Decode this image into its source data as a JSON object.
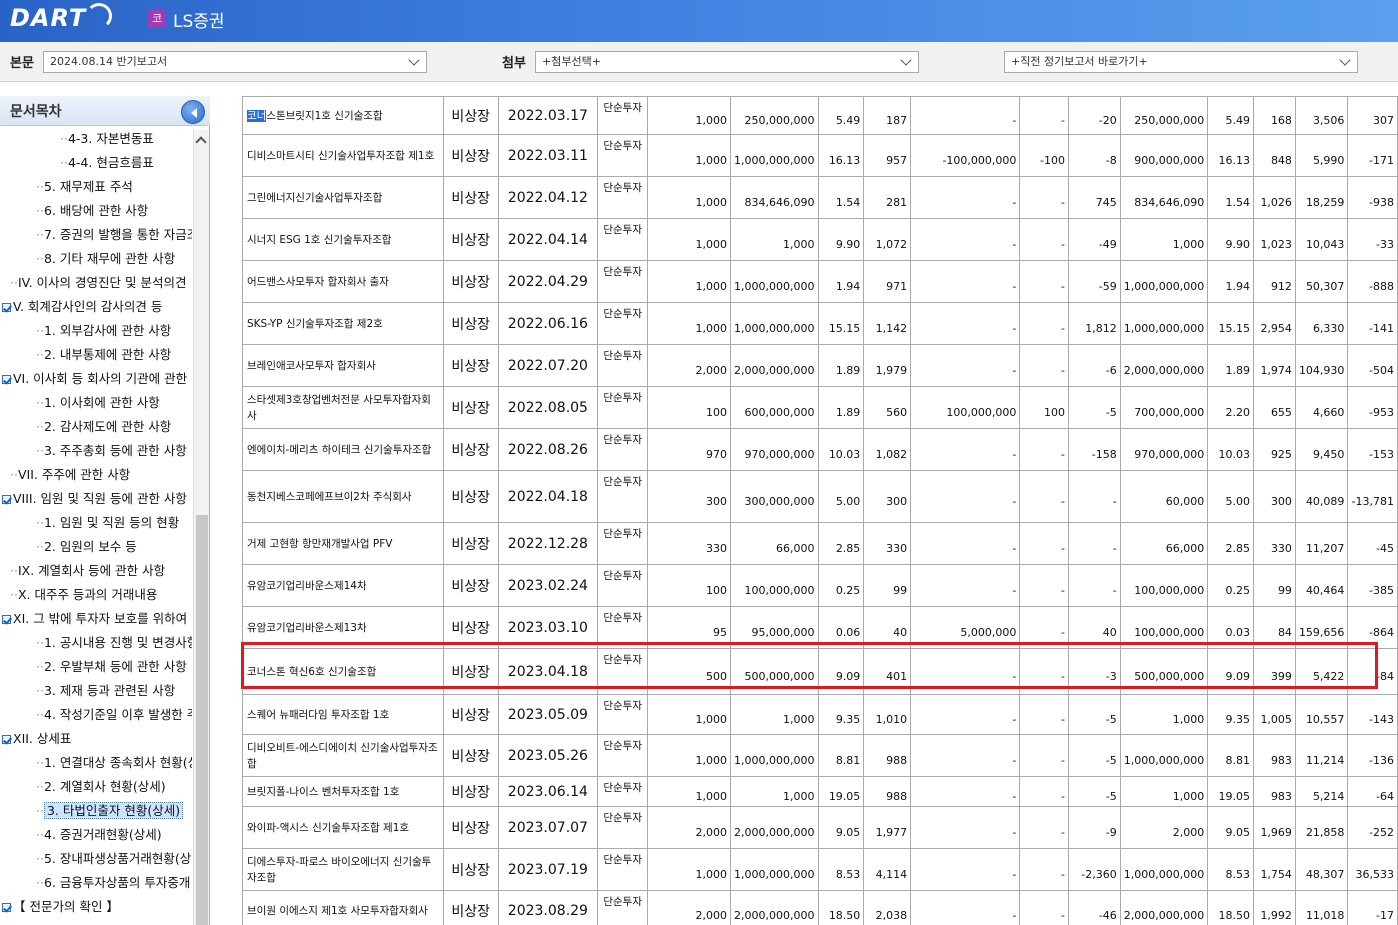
{
  "header": {
    "logo_text": "DART",
    "company_badge": "코",
    "company_name": "LS증권"
  },
  "toolbar": {
    "main_label": "본문",
    "main_select": "2024.08.14  반기보고서",
    "attach_label": "첨부",
    "attach_select": "+첨부선택+",
    "recent_select": "+직전 정기보고서 바로가기+"
  },
  "sidebar": {
    "title": "문서목차",
    "items": [
      {
        "label": "4-3. 자본변동표",
        "indent": 3
      },
      {
        "label": "4-4. 현금흐름표",
        "indent": 3
      },
      {
        "label": "5. 재무제표 주석",
        "indent": 2
      },
      {
        "label": "6. 배당에 관한 사항",
        "indent": 2
      },
      {
        "label": "7. 증권의 발행을 통한 자금조",
        "indent": 2
      },
      {
        "label": "8. 기타 재무에 관한 사항",
        "indent": 2
      },
      {
        "label": "IV. 이사의 경영진단 및 분석의견",
        "indent": 1
      },
      {
        "label": "V. 회계감사인의 감사의견 등",
        "indent": 0,
        "check": true
      },
      {
        "label": "1. 외부감사에 관한 사항",
        "indent": 2
      },
      {
        "label": "2. 내부통제에 관한 사항",
        "indent": 2
      },
      {
        "label": "VI. 이사회 등 회사의 기관에 관한",
        "indent": 0,
        "check": true
      },
      {
        "label": "1. 이사회에 관한 사항",
        "indent": 2
      },
      {
        "label": "2. 감사제도에 관한 사항",
        "indent": 2
      },
      {
        "label": "3. 주주총회 등에 관한 사항",
        "indent": 2
      },
      {
        "label": "VII. 주주에 관한 사항",
        "indent": 1
      },
      {
        "label": "VIII. 임원 및 직원 등에 관한 사항",
        "indent": 0,
        "check": true
      },
      {
        "label": "1. 임원 및 직원 등의 현황",
        "indent": 2
      },
      {
        "label": "2. 임원의 보수 등",
        "indent": 2
      },
      {
        "label": "IX. 계열회사 등에 관한 사항",
        "indent": 1
      },
      {
        "label": "X. 대주주 등과의 거래내용",
        "indent": 1
      },
      {
        "label": "XI. 그 밖에 투자자 보호를 위하여",
        "indent": 0,
        "check": true
      },
      {
        "label": "1. 공시내용 진행 및 변경사항",
        "indent": 2
      },
      {
        "label": "2. 우발부채 등에 관한 사항",
        "indent": 2
      },
      {
        "label": "3. 제재 등과 관련된 사항",
        "indent": 2
      },
      {
        "label": "4. 작성기준일 이후 발생한 주",
        "indent": 2
      },
      {
        "label": "XII. 상세표",
        "indent": 0,
        "check": true
      },
      {
        "label": "1. 연결대상 종속회사 현황(상",
        "indent": 2
      },
      {
        "label": "2. 계열회사 현황(상세)",
        "indent": 2
      },
      {
        "label": "3. 타법인출자 현황(상세)",
        "indent": 2,
        "selected": true
      },
      {
        "label": "4. 증권거래현황(상세)",
        "indent": 2
      },
      {
        "label": "5. 장내파생상품거래현황(상",
        "indent": 2
      },
      {
        "label": "6. 금융투자상품의 투자중개",
        "indent": 2
      },
      {
        "label": "【 전문가의 확인 】",
        "indent": 0,
        "check": true
      }
    ]
  },
  "table": {
    "rows": [
      {
        "name": "코너스톤브릿지1호 신기술조합",
        "name_hl": "코너",
        "listed": "비상장",
        "date": "2022.03.17",
        "purpose": "단순투자",
        "c1": "1,000",
        "c2": "250,000,000",
        "c3": "5.49",
        "c4": "187",
        "c5": "-",
        "c6": "-",
        "c7": "-20",
        "c8": "250,000,000",
        "c9": "5.49",
        "c10": "168",
        "c11": "3,506",
        "c12": "307"
      },
      {
        "name": "디비스마트시티 신기술사업투자조합 제1호",
        "listed": "비상장",
        "date": "2022.03.11",
        "purpose": "단순투자",
        "c1": "1,000",
        "c2": "1,000,000,000",
        "c3": "16.13",
        "c4": "957",
        "c5": "-100,000,000",
        "c6": "-100",
        "c7": "-8",
        "c8": "900,000,000",
        "c9": "16.13",
        "c10": "848",
        "c11": "5,990",
        "c12": "-171"
      },
      {
        "name": "그린에너지신기술사업투자조합",
        "listed": "비상장",
        "date": "2022.04.12",
        "purpose": "단순투자",
        "c1": "1,000",
        "c2": "834,646,090",
        "c3": "1.54",
        "c4": "281",
        "c5": "-",
        "c6": "-",
        "c7": "745",
        "c8": "834,646,090",
        "c9": "1.54",
        "c10": "1,026",
        "c11": "18,259",
        "c12": "-938"
      },
      {
        "name": "시너지 ESG 1호 신기술투자조합",
        "listed": "비상장",
        "date": "2022.04.14",
        "purpose": "단순투자",
        "c1": "1,000",
        "c2": "1,000",
        "c3": "9.90",
        "c4": "1,072",
        "c5": "-",
        "c6": "-",
        "c7": "-49",
        "c8": "1,000",
        "c9": "9.90",
        "c10": "1,023",
        "c11": "10,043",
        "c12": "-33"
      },
      {
        "name": "어드밴스사모투자 합자회사 출자",
        "listed": "비상장",
        "date": "2022.04.29",
        "purpose": "단순투자",
        "c1": "1,000",
        "c2": "1,000,000,000",
        "c3": "1.94",
        "c4": "971",
        "c5": "-",
        "c6": "-",
        "c7": "-59",
        "c8": "1,000,000,000",
        "c9": "1.94",
        "c10": "912",
        "c11": "50,307",
        "c12": "-888"
      },
      {
        "name": "SKS-YP 신기술투자조합 제2호",
        "listed": "비상장",
        "date": "2022.06.16",
        "purpose": "단순투자",
        "c1": "1,000",
        "c2": "1,000,000,000",
        "c3": "15.15",
        "c4": "1,142",
        "c5": "-",
        "c6": "-",
        "c7": "1,812",
        "c8": "1,000,000,000",
        "c9": "15.15",
        "c10": "2,954",
        "c11": "6,330",
        "c12": "-141"
      },
      {
        "name": "브레인애코사모투자 합자회사",
        "listed": "비상장",
        "date": "2022.07.20",
        "purpose": "단순투자",
        "c1": "2,000",
        "c2": "2,000,000,000",
        "c3": "1.89",
        "c4": "1,979",
        "c5": "-",
        "c6": "-",
        "c7": "-6",
        "c8": "2,000,000,000",
        "c9": "1.89",
        "c10": "1,974",
        "c11": "104,930",
        "c12": "-504"
      },
      {
        "name": "스타셋제3호창업벤처전문 사모투자합자회사",
        "listed": "비상장",
        "date": "2022.08.05",
        "purpose": "단순투자",
        "c1": "100",
        "c2": "600,000,000",
        "c3": "1.89",
        "c4": "560",
        "c5": "100,000,000",
        "c6": "100",
        "c7": "-5",
        "c8": "700,000,000",
        "c9": "2.20",
        "c10": "655",
        "c11": "4,660",
        "c12": "-953"
      },
      {
        "name": "엔에이치-메리츠 하이테크 신기술투자조합",
        "listed": "비상장",
        "date": "2022.08.26",
        "purpose": "단순투자",
        "c1": "970",
        "c2": "970,000,000",
        "c3": "10.03",
        "c4": "1,082",
        "c5": "-",
        "c6": "-",
        "c7": "-158",
        "c8": "970,000,000",
        "c9": "10.03",
        "c10": "925",
        "c11": "9,450",
        "c12": "-153"
      },
      {
        "name": "동천지베스코페에프브이2차 주식회사",
        "listed": "비상장",
        "date": "2022.04.18",
        "purpose": "단순투자",
        "c1": "300",
        "c2": "300,000,000",
        "c3": "5.00",
        "c4": "300",
        "c5": "-",
        "c6": "-",
        "c7": "-",
        "c8": "60,000",
        "c9": "5.00",
        "c10": "300",
        "c11": "40,089",
        "c12": "-13,781"
      },
      {
        "name": "거제 고현항 항만재개발사업 PFV",
        "listed": "비상장",
        "date": "2022.12.28",
        "purpose": "단순투자",
        "c1": "330",
        "c2": "66,000",
        "c3": "2.85",
        "c4": "330",
        "c5": "-",
        "c6": "-",
        "c7": "-",
        "c8": "66,000",
        "c9": "2.85",
        "c10": "330",
        "c11": "11,207",
        "c12": "-45"
      },
      {
        "name": "유암코기업리바운스제14차",
        "listed": "비상장",
        "date": "2023.02.24",
        "purpose": "단순투자",
        "c1": "100",
        "c2": "100,000,000",
        "c3": "0.25",
        "c4": "99",
        "c5": "-",
        "c6": "-",
        "c7": "-",
        "c8": "100,000,000",
        "c9": "0.25",
        "c10": "99",
        "c11": "40,464",
        "c12": "-385"
      },
      {
        "name": "유암코기업리바운스제13차",
        "listed": "비상장",
        "date": "2023.03.10",
        "purpose": "단순투자",
        "c1": "95",
        "c2": "95,000,000",
        "c3": "0.06",
        "c4": "40",
        "c5": "5,000,000",
        "c6": "-",
        "c7": "40",
        "c8": "100,000,000",
        "c9": "0.03",
        "c10": "84",
        "c11": "159,656",
        "c12": "-864"
      },
      {
        "name": "코너스톤 혁신6호 신기술조합",
        "listed": "비상장",
        "date": "2023.04.18",
        "purpose": "단순투자",
        "c1": "500",
        "c2": "500,000,000",
        "c3": "9.09",
        "c4": "401",
        "c5": "-",
        "c6": "-",
        "c7": "-3",
        "c8": "500,000,000",
        "c9": "9.09",
        "c10": "399",
        "c11": "5,422",
        "c12": "-84"
      },
      {
        "name": "스퀘어 뉴패러다임 투자조합 1호",
        "listed": "비상장",
        "date": "2023.05.09",
        "purpose": "단순투자",
        "c1": "1,000",
        "c2": "1,000",
        "c3": "9.35",
        "c4": "1,010",
        "c5": "-",
        "c6": "-",
        "c7": "-5",
        "c8": "1,000",
        "c9": "9.35",
        "c10": "1,005",
        "c11": "10,557",
        "c12": "-143"
      },
      {
        "name": "디비오비트-에스디에이치 신기술사업투자조합",
        "listed": "비상장",
        "date": "2023.05.26",
        "purpose": "단순투자",
        "c1": "1,000",
        "c2": "1,000,000,000",
        "c3": "8.81",
        "c4": "988",
        "c5": "-",
        "c6": "-",
        "c7": "-5",
        "c8": "1,000,000,000",
        "c9": "8.81",
        "c10": "983",
        "c11": "11,214",
        "c12": "-136"
      },
      {
        "name": "브릿지폴-나이스 벤처투자조합 1호",
        "listed": "비상장",
        "date": "2023.06.14",
        "purpose": "단순투자",
        "c1": "1,000",
        "c2": "1,000",
        "c3": "19.05",
        "c4": "988",
        "c5": "-",
        "c6": "-",
        "c7": "-5",
        "c8": "1,000",
        "c9": "19.05",
        "c10": "983",
        "c11": "5,214",
        "c12": "-64"
      },
      {
        "name": "와이파-액시스 신기술투자조합 제1호",
        "listed": "비상장",
        "date": "2023.07.07",
        "purpose": "단순투자",
        "c1": "2,000",
        "c2": "2,000,000,000",
        "c3": "9.05",
        "c4": "1,977",
        "c5": "-",
        "c6": "-",
        "c7": "-9",
        "c8": "2,000",
        "c9": "9.05",
        "c10": "1,969",
        "c11": "21,858",
        "c12": "-252"
      },
      {
        "name": "디에스투자-파로스 바이오에너지 신기술투자조합",
        "listed": "비상장",
        "date": "2023.07.19",
        "purpose": "단순투자",
        "c1": "1,000",
        "c2": "1,000,000,000",
        "c3": "8.53",
        "c4": "4,114",
        "c5": "-",
        "c6": "-",
        "c7": "-2,360",
        "c8": "1,000,000,000",
        "c9": "8.53",
        "c10": "1,754",
        "c11": "48,307",
        "c12": "36,533"
      },
      {
        "name": "브이원 이에스지 제1호 사모투자합자회사",
        "listed": "비상장",
        "date": "2023.08.29",
        "purpose": "단순투자",
        "c1": "2,000",
        "c2": "2,000,000,000",
        "c3": "18.50",
        "c4": "2,038",
        "c5": "-",
        "c6": "-",
        "c7": "-46",
        "c8": "2,000,000,000",
        "c9": "18.50",
        "c10": "1,992",
        "c11": "11,018",
        "c12": "-17"
      }
    ]
  }
}
